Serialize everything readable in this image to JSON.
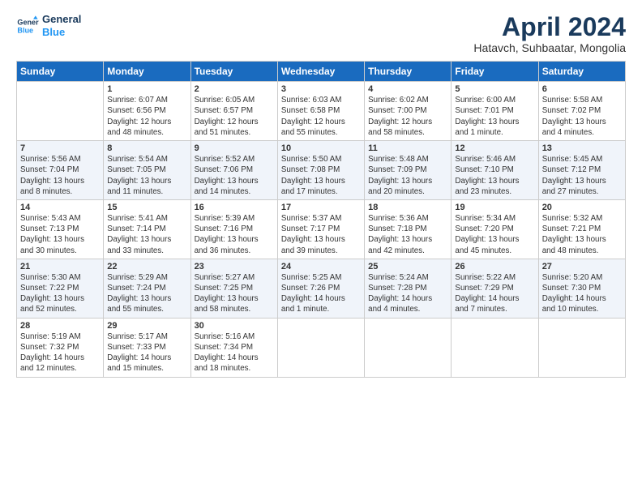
{
  "logo": {
    "line1": "General",
    "line2": "Blue"
  },
  "title": "April 2024",
  "subtitle": "Hatavch, Suhbaatar, Mongolia",
  "days_of_week": [
    "Sunday",
    "Monday",
    "Tuesday",
    "Wednesday",
    "Thursday",
    "Friday",
    "Saturday"
  ],
  "weeks": [
    [
      {
        "num": "",
        "info": ""
      },
      {
        "num": "1",
        "info": "Sunrise: 6:07 AM\nSunset: 6:56 PM\nDaylight: 12 hours\nand 48 minutes."
      },
      {
        "num": "2",
        "info": "Sunrise: 6:05 AM\nSunset: 6:57 PM\nDaylight: 12 hours\nand 51 minutes."
      },
      {
        "num": "3",
        "info": "Sunrise: 6:03 AM\nSunset: 6:58 PM\nDaylight: 12 hours\nand 55 minutes."
      },
      {
        "num": "4",
        "info": "Sunrise: 6:02 AM\nSunset: 7:00 PM\nDaylight: 12 hours\nand 58 minutes."
      },
      {
        "num": "5",
        "info": "Sunrise: 6:00 AM\nSunset: 7:01 PM\nDaylight: 13 hours\nand 1 minute."
      },
      {
        "num": "6",
        "info": "Sunrise: 5:58 AM\nSunset: 7:02 PM\nDaylight: 13 hours\nand 4 minutes."
      }
    ],
    [
      {
        "num": "7",
        "info": "Sunrise: 5:56 AM\nSunset: 7:04 PM\nDaylight: 13 hours\nand 8 minutes."
      },
      {
        "num": "8",
        "info": "Sunrise: 5:54 AM\nSunset: 7:05 PM\nDaylight: 13 hours\nand 11 minutes."
      },
      {
        "num": "9",
        "info": "Sunrise: 5:52 AM\nSunset: 7:06 PM\nDaylight: 13 hours\nand 14 minutes."
      },
      {
        "num": "10",
        "info": "Sunrise: 5:50 AM\nSunset: 7:08 PM\nDaylight: 13 hours\nand 17 minutes."
      },
      {
        "num": "11",
        "info": "Sunrise: 5:48 AM\nSunset: 7:09 PM\nDaylight: 13 hours\nand 20 minutes."
      },
      {
        "num": "12",
        "info": "Sunrise: 5:46 AM\nSunset: 7:10 PM\nDaylight: 13 hours\nand 23 minutes."
      },
      {
        "num": "13",
        "info": "Sunrise: 5:45 AM\nSunset: 7:12 PM\nDaylight: 13 hours\nand 27 minutes."
      }
    ],
    [
      {
        "num": "14",
        "info": "Sunrise: 5:43 AM\nSunset: 7:13 PM\nDaylight: 13 hours\nand 30 minutes."
      },
      {
        "num": "15",
        "info": "Sunrise: 5:41 AM\nSunset: 7:14 PM\nDaylight: 13 hours\nand 33 minutes."
      },
      {
        "num": "16",
        "info": "Sunrise: 5:39 AM\nSunset: 7:16 PM\nDaylight: 13 hours\nand 36 minutes."
      },
      {
        "num": "17",
        "info": "Sunrise: 5:37 AM\nSunset: 7:17 PM\nDaylight: 13 hours\nand 39 minutes."
      },
      {
        "num": "18",
        "info": "Sunrise: 5:36 AM\nSunset: 7:18 PM\nDaylight: 13 hours\nand 42 minutes."
      },
      {
        "num": "19",
        "info": "Sunrise: 5:34 AM\nSunset: 7:20 PM\nDaylight: 13 hours\nand 45 minutes."
      },
      {
        "num": "20",
        "info": "Sunrise: 5:32 AM\nSunset: 7:21 PM\nDaylight: 13 hours\nand 48 minutes."
      }
    ],
    [
      {
        "num": "21",
        "info": "Sunrise: 5:30 AM\nSunset: 7:22 PM\nDaylight: 13 hours\nand 52 minutes."
      },
      {
        "num": "22",
        "info": "Sunrise: 5:29 AM\nSunset: 7:24 PM\nDaylight: 13 hours\nand 55 minutes."
      },
      {
        "num": "23",
        "info": "Sunrise: 5:27 AM\nSunset: 7:25 PM\nDaylight: 13 hours\nand 58 minutes."
      },
      {
        "num": "24",
        "info": "Sunrise: 5:25 AM\nSunset: 7:26 PM\nDaylight: 14 hours\nand 1 minute."
      },
      {
        "num": "25",
        "info": "Sunrise: 5:24 AM\nSunset: 7:28 PM\nDaylight: 14 hours\nand 4 minutes."
      },
      {
        "num": "26",
        "info": "Sunrise: 5:22 AM\nSunset: 7:29 PM\nDaylight: 14 hours\nand 7 minutes."
      },
      {
        "num": "27",
        "info": "Sunrise: 5:20 AM\nSunset: 7:30 PM\nDaylight: 14 hours\nand 10 minutes."
      }
    ],
    [
      {
        "num": "28",
        "info": "Sunrise: 5:19 AM\nSunset: 7:32 PM\nDaylight: 14 hours\nand 12 minutes."
      },
      {
        "num": "29",
        "info": "Sunrise: 5:17 AM\nSunset: 7:33 PM\nDaylight: 14 hours\nand 15 minutes."
      },
      {
        "num": "30",
        "info": "Sunrise: 5:16 AM\nSunset: 7:34 PM\nDaylight: 14 hours\nand 18 minutes."
      },
      {
        "num": "",
        "info": ""
      },
      {
        "num": "",
        "info": ""
      },
      {
        "num": "",
        "info": ""
      },
      {
        "num": "",
        "info": ""
      }
    ]
  ]
}
